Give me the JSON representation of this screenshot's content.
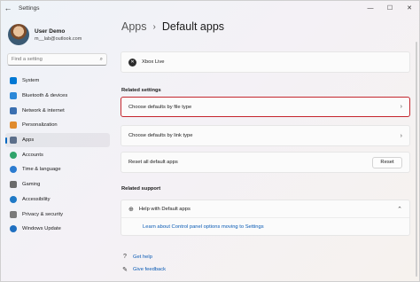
{
  "window": {
    "title": "Settings",
    "back_glyph": "←",
    "minimize_glyph": "—",
    "maximize_glyph": "☐",
    "close_glyph": "✕"
  },
  "user": {
    "name": "User Demo",
    "email": "m__lab@outlook.com"
  },
  "search": {
    "placeholder": "Find a setting"
  },
  "nav": {
    "items": [
      {
        "label": "System",
        "color": "#0078d4"
      },
      {
        "label": "Bluetooth & devices",
        "color": "#2b88d8"
      },
      {
        "label": "Network & internet",
        "color": "#3a6fb0"
      },
      {
        "label": "Personalization",
        "color": "#e08b2d"
      },
      {
        "label": "Apps",
        "color": "#5c6f8a"
      },
      {
        "label": "Accounts",
        "color": "#2fa36b"
      },
      {
        "label": "Time & language",
        "color": "#2b7bd0"
      },
      {
        "label": "Gaming",
        "color": "#6b6b6b"
      },
      {
        "label": "Accessibility",
        "color": "#1f79c6"
      },
      {
        "label": "Privacy & security",
        "color": "#7a7a7a"
      },
      {
        "label": "Windows Update",
        "color": "#1f6fc0"
      }
    ],
    "active_index": 4
  },
  "breadcrumb": {
    "parent": "Apps",
    "separator": "›",
    "current": "Default apps"
  },
  "xbox_item": {
    "label": "Xbox Live"
  },
  "related_settings": {
    "heading": "Related settings",
    "file_type": "Choose defaults by file type",
    "link_type": "Choose defaults by link type",
    "reset_label": "Reset all default apps",
    "reset_button": "Reset"
  },
  "related_support": {
    "heading": "Related support",
    "help_title": "Help with Default apps",
    "help_link": "Learn about Control panel options moving to Settings"
  },
  "footer": {
    "get_help": "Get help",
    "give_feedback": "Give feedback"
  },
  "chevron": "›",
  "chevron_up": "⌃",
  "colors": {
    "accent": "#0067c0",
    "highlight": "#c4262e",
    "link": "#0a5bb5"
  }
}
